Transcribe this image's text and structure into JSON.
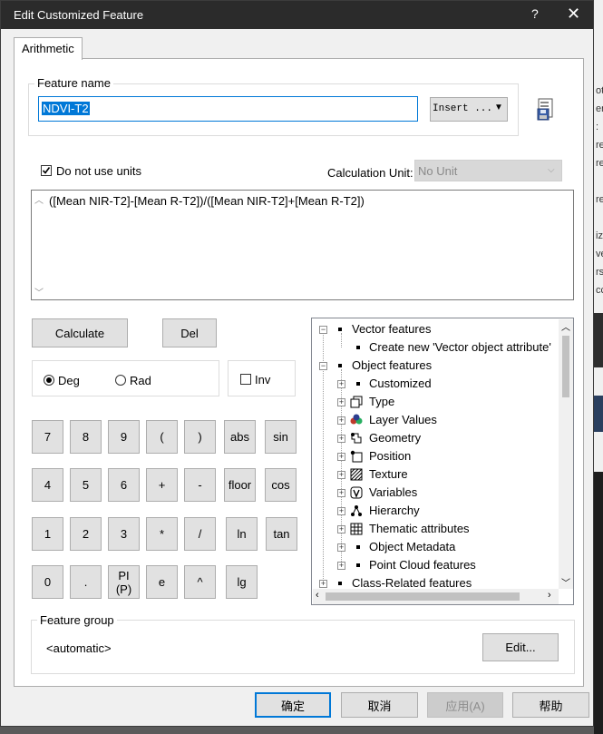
{
  "window": {
    "title": "Edit Customized Feature",
    "help": "?",
    "close": "✕"
  },
  "tab": {
    "label": "Arithmetic"
  },
  "feature_name": {
    "group_label": "Feature name",
    "value": "NDVI-T2",
    "insert_label": "Insert ..."
  },
  "units": {
    "checkbox_label": "Do not use units",
    "checked": true,
    "calc_unit_label": "Calculation Unit:",
    "calc_unit_value": "No Unit"
  },
  "formula": {
    "text": "([Mean NIR-T2]-[Mean R-T2])/([Mean NIR-T2]+[Mean R-T2])"
  },
  "actions": {
    "calculate": "Calculate",
    "del": "Del"
  },
  "angle": {
    "deg": "Deg",
    "rad": "Rad",
    "inv": "Inv"
  },
  "keypad": [
    [
      "7",
      "8",
      "9",
      "(",
      ")",
      "abs",
      "sin"
    ],
    [
      "4",
      "5",
      "6",
      "+",
      "-",
      "floor",
      "cos"
    ],
    [
      "1",
      "2",
      "3",
      "*",
      "/",
      "ln",
      "tan"
    ],
    [
      "0",
      ".",
      "PI (P)",
      "e",
      "^",
      "lg"
    ]
  ],
  "tree": [
    {
      "label": "Vector features",
      "level": 0,
      "expander": "−",
      "icon": "bullet"
    },
    {
      "label": "Create new 'Vector object attribute'",
      "level": 1,
      "expander": "",
      "icon": "bullet"
    },
    {
      "label": "Object features",
      "level": 0,
      "expander": "−",
      "icon": "bullet"
    },
    {
      "label": "Customized",
      "level": 1,
      "expander": "+",
      "icon": "bullet"
    },
    {
      "label": "Type",
      "level": 1,
      "expander": "+",
      "icon": "type-icon"
    },
    {
      "label": "Layer Values",
      "level": 1,
      "expander": "+",
      "icon": "layer-values-icon"
    },
    {
      "label": "Geometry",
      "level": 1,
      "expander": "+",
      "icon": "geometry-icon"
    },
    {
      "label": "Position",
      "level": 1,
      "expander": "+",
      "icon": "position-icon"
    },
    {
      "label": "Texture",
      "level": 1,
      "expander": "+",
      "icon": "texture-icon"
    },
    {
      "label": "Variables",
      "level": 1,
      "expander": "+",
      "icon": "variables-icon"
    },
    {
      "label": "Hierarchy",
      "level": 1,
      "expander": "+",
      "icon": "hierarchy-icon"
    },
    {
      "label": "Thematic attributes",
      "level": 1,
      "expander": "+",
      "icon": "thematic-icon"
    },
    {
      "label": "Object Metadata",
      "level": 1,
      "expander": "+",
      "icon": "bullet"
    },
    {
      "label": "Point Cloud features",
      "level": 1,
      "expander": "+",
      "icon": "bullet"
    },
    {
      "label": "Class-Related features",
      "level": 0,
      "expander": "+",
      "icon": "bullet"
    }
  ],
  "feature_group": {
    "label": "Feature group",
    "value": "<automatic>",
    "edit": "Edit..."
  },
  "footer": {
    "ok": "确定",
    "cancel": "取消",
    "apply": "应用(A)",
    "help": "帮助"
  },
  "background_glimpse": [
    "ot",
    "er",
    ":",
    "re",
    "re",
    "re",
    "iz",
    "ve",
    "rs",
    "cc"
  ]
}
